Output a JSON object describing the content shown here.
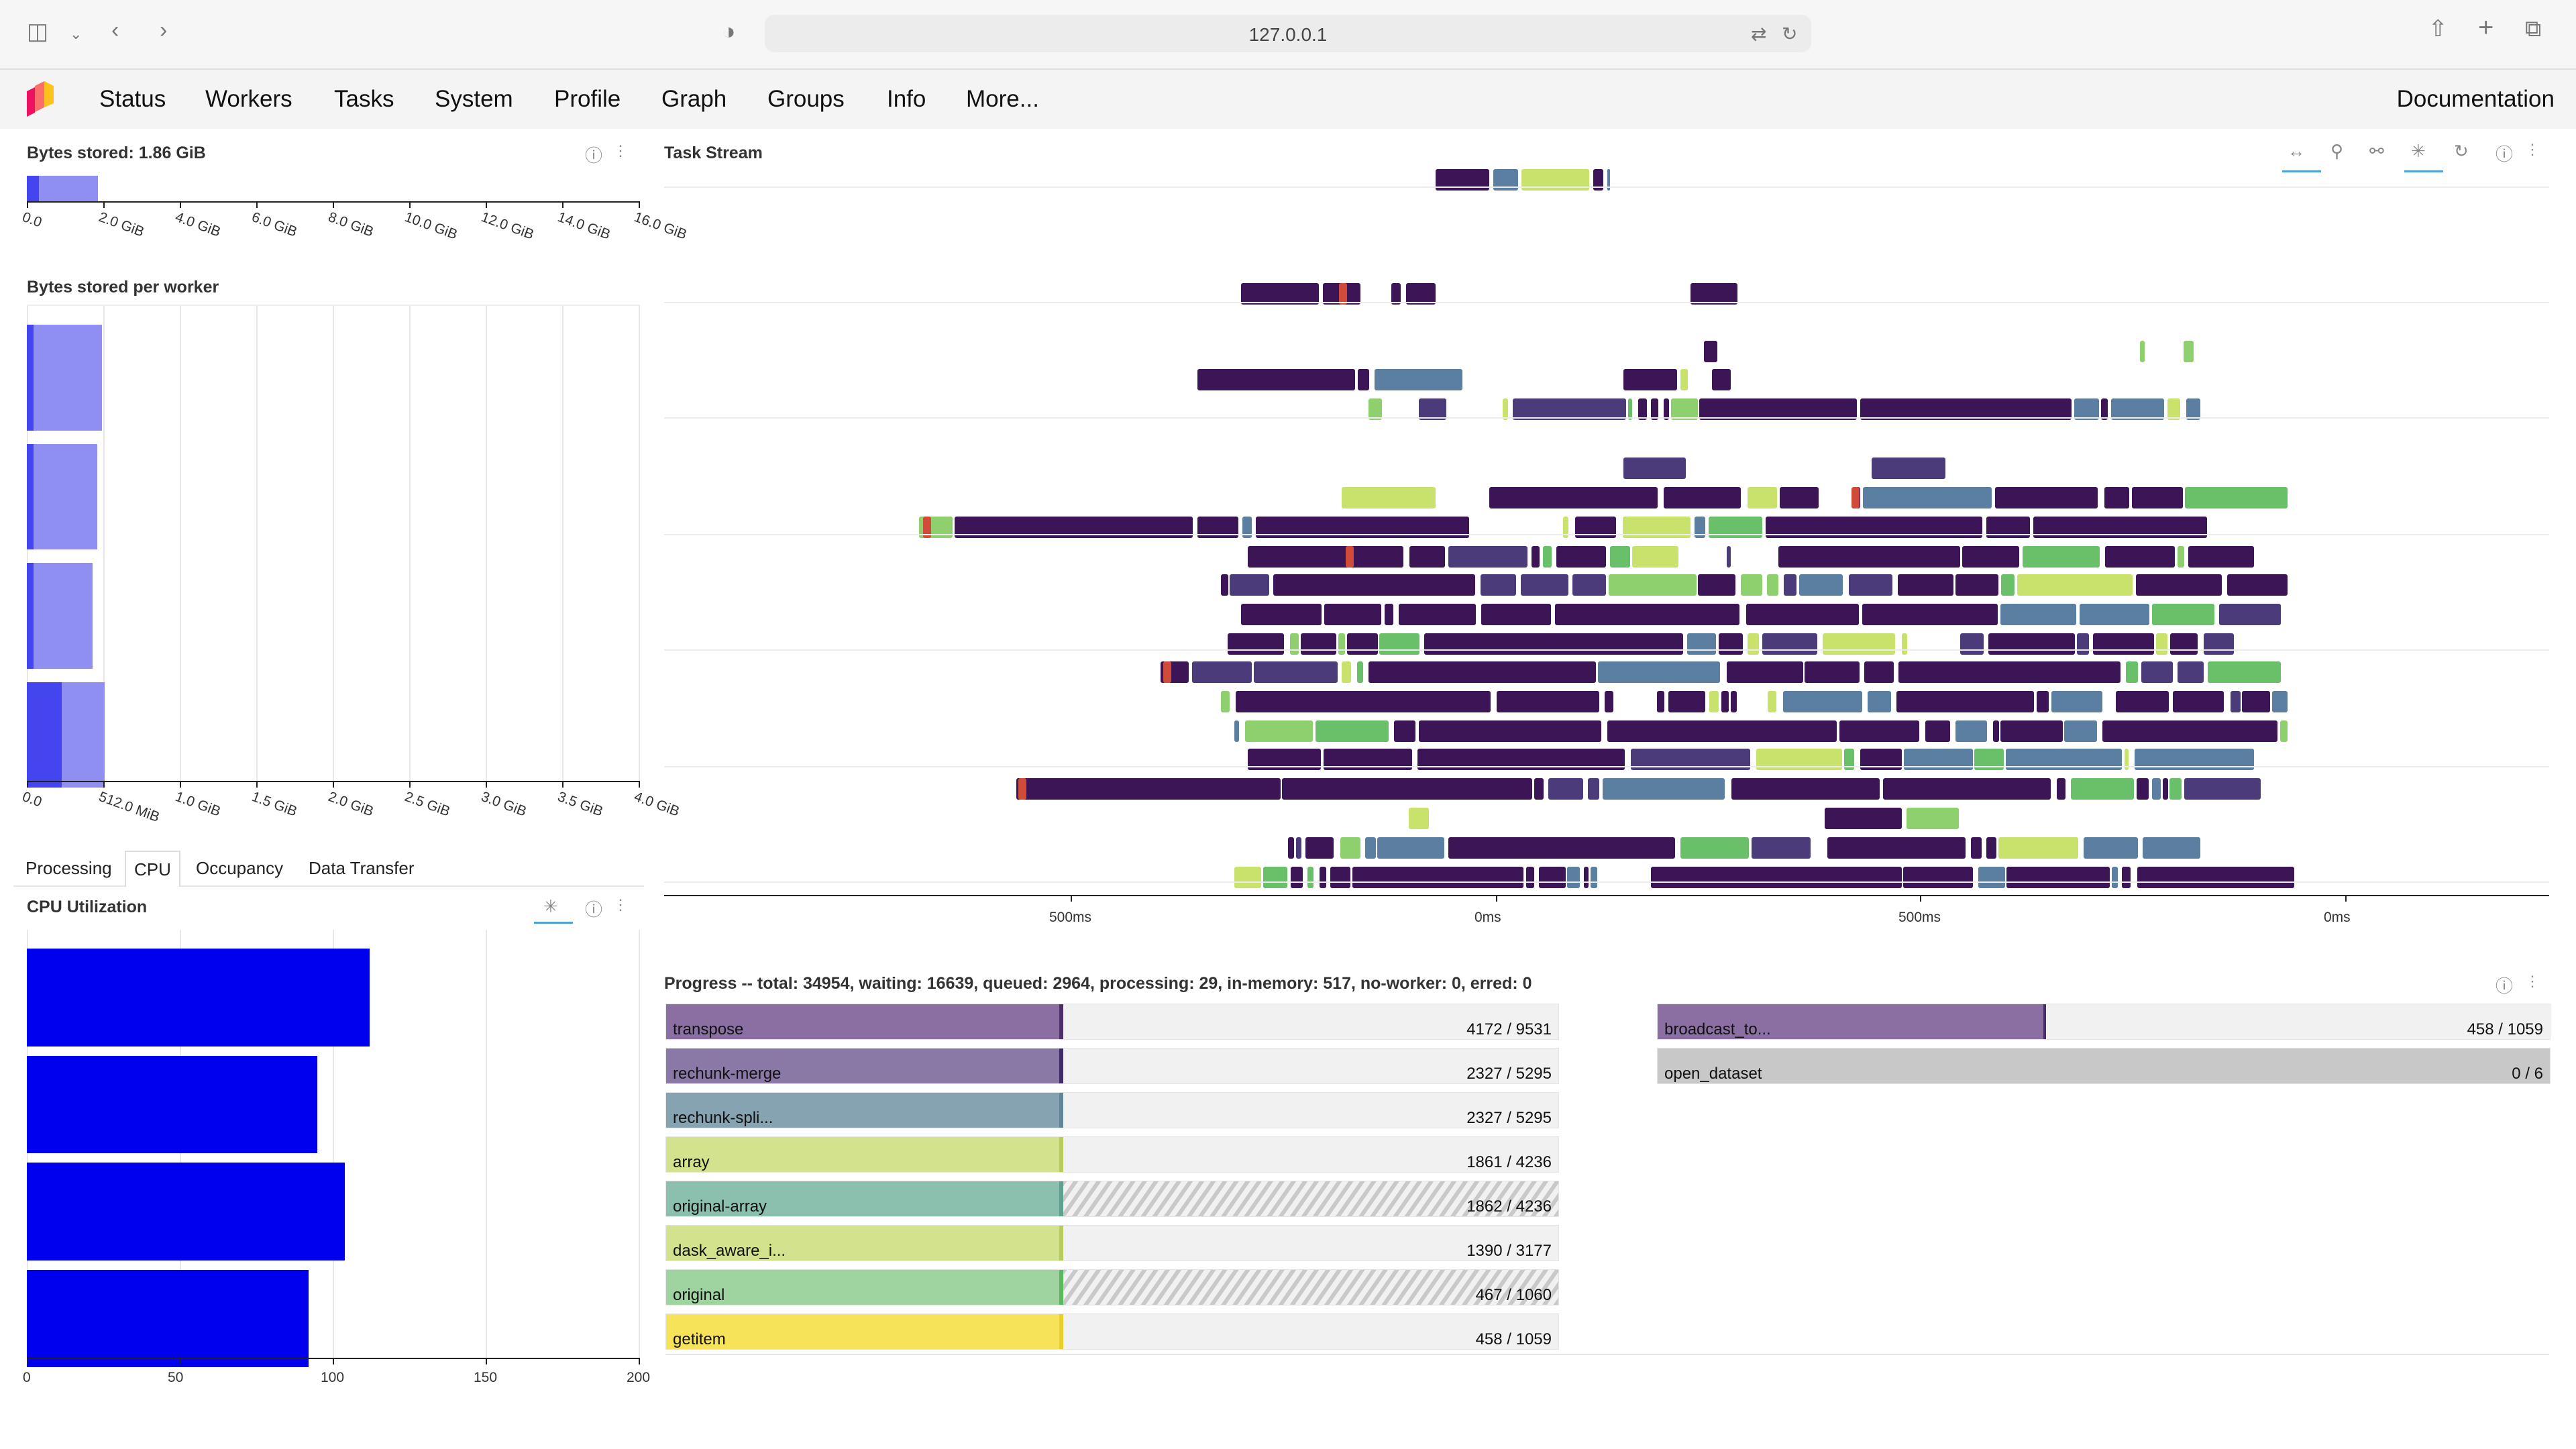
{
  "browser": {
    "url": "127.0.0.1"
  },
  "nav": {
    "items": [
      "Status",
      "Workers",
      "Tasks",
      "System",
      "Profile",
      "Graph",
      "Groups",
      "Info",
      "More..."
    ],
    "documentation": "Documentation"
  },
  "bytes_stored": {
    "title": "Bytes stored: 1.86 GiB",
    "ticks": [
      "0.0",
      "2.0 GiB",
      "4.0 GiB",
      "6.0 GiB",
      "8.0 GiB",
      "10.0 GiB",
      "12.0 GiB",
      "14.0 GiB",
      "16.0 GiB"
    ],
    "value_gib": 1.86,
    "max_gib": 16
  },
  "bytes_per_worker": {
    "title": "Bytes stored per worker",
    "ticks": [
      "0.0",
      "512.0 MiB",
      "1.0 GiB",
      "1.5 GiB",
      "2.0 GiB",
      "2.5 GiB",
      "3.0 GiB",
      "3.5 GiB",
      "4.0 GiB"
    ],
    "workers": [
      {
        "dark": 0.04,
        "total": 0.49
      },
      {
        "dark": 0.04,
        "total": 0.46
      },
      {
        "dark": 0.04,
        "total": 0.43
      },
      {
        "dark": 0.23,
        "total": 0.51
      }
    ],
    "max_gib": 4.0
  },
  "tabs": {
    "items": [
      "Processing",
      "CPU",
      "Occupancy",
      "Data Transfer"
    ],
    "active": "CPU"
  },
  "cpu": {
    "title": "CPU Utilization",
    "ticks": [
      "0",
      "50",
      "100",
      "150",
      "200"
    ],
    "values": [
      112,
      95,
      104,
      92
    ],
    "max": 200
  },
  "task_stream": {
    "title": "Task Stream",
    "x_ticks": [
      "500ms",
      "0ms",
      "500ms",
      "0ms"
    ]
  },
  "progress": {
    "title": "Progress -- total: 34954, waiting: 16639, queued: 2964, processing: 29, in-memory: 517, no-worker: 0, erred: 0",
    "left": [
      {
        "name": "transpose",
        "count": "4172 / 9531",
        "frac": 0.785,
        "color": "#8b6fa3",
        "edge": "#4b2e6a",
        "hatch": 0
      },
      {
        "name": "rechunk-merge",
        "count": "2327 / 5295",
        "frac": 0.785,
        "color": "#8a79a6",
        "edge": "#3e2b6b",
        "hatch": 0
      },
      {
        "name": "rechunk-spli...",
        "count": "2327 / 5295",
        "frac": 0.785,
        "color": "#85a3b0",
        "edge": "#5f8797",
        "hatch": 0
      },
      {
        "name": "array",
        "count": "1861 / 4236",
        "frac": 0.785,
        "color": "#d3e28d",
        "edge": "#b7cc5e",
        "hatch": 0
      },
      {
        "name": "original-array",
        "count": "1862 / 4236",
        "frac": 0.785,
        "color": "#8bbfae",
        "edge": "#5fa090",
        "hatch": 1
      },
      {
        "name": "dask_aware_i...",
        "count": "1390 / 3177",
        "frac": 0.785,
        "color": "#d3e28d",
        "edge": "#b7cc5e",
        "hatch": 0
      },
      {
        "name": "original",
        "count": "467 / 1060",
        "frac": 0.785,
        "color": "#9fd39f",
        "edge": "#5cb85c",
        "hatch": 1
      },
      {
        "name": "getitem",
        "count": "458 / 1059",
        "frac": 0.775,
        "color": "#f7e35a",
        "edge": "#e8cf2a",
        "hatch": 0
      }
    ],
    "right": [
      {
        "name": "broadcast_to...",
        "count": "458 / 1059",
        "frac": 0.435,
        "color": "#8b6fa3",
        "edge": "#4b2e6a"
      },
      {
        "name": "open_dataset",
        "count": "0 / 6",
        "frac": 1.0,
        "color": "#c8c8c8",
        "edge": "#c8c8c8"
      }
    ]
  },
  "colors": {
    "purple": "#3b1556",
    "green": "#8fd06e",
    "lightgreen": "#6abf69",
    "lime": "#c9e26b",
    "red": "#d14b3b",
    "blue": "#0000ee",
    "memory": "#8f8ff2"
  }
}
